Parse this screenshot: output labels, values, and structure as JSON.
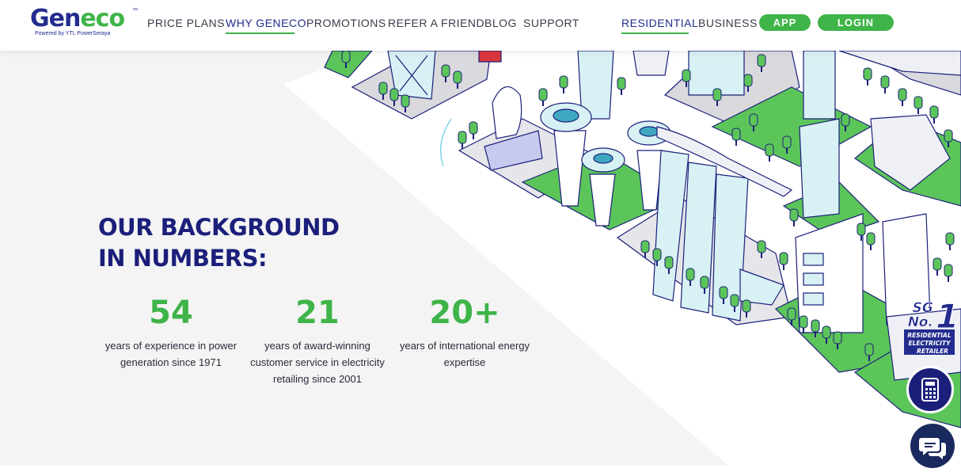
{
  "logo": {
    "brand_part1": "Gen",
    "brand_part2": "eco",
    "trademark": "™",
    "tagline": "Powered by YTL PowerSeraya"
  },
  "nav": {
    "items": [
      {
        "label": "PRICE PLANS"
      },
      {
        "label": "WHY GENECO"
      },
      {
        "label": "PROMOTIONS"
      },
      {
        "label": "REFER A FRIEND"
      },
      {
        "label": "BLOG"
      },
      {
        "label": "SUPPORT"
      }
    ],
    "segments": [
      {
        "label": "RESIDENTIAL"
      },
      {
        "label": "BUSINESS"
      }
    ],
    "app_label": "APP",
    "login_label": "LOGIN"
  },
  "section": {
    "heading_line1": "OUR BACKGROUND",
    "heading_line2": "IN NUMBERS:"
  },
  "stats": [
    {
      "value": "54",
      "desc_line1": "years of experience in power",
      "desc_line2": "generation since 1971",
      "desc_line3": ""
    },
    {
      "value": "21",
      "desc_line1": "years of award-winning",
      "desc_line2": "customer service in electricity",
      "desc_line3": "retailing since 2001"
    },
    {
      "value": "20+",
      "desc_line1": "years of international energy",
      "desc_line2": "expertise",
      "desc_line3": ""
    }
  ],
  "badge": {
    "line1": "SG",
    "line2": "No.",
    "number": "1",
    "line3": "RESIDENTIAL",
    "line4": "ELECTRICITY",
    "line5": "RETAILER"
  },
  "icons": {
    "calculator": "calculator-icon",
    "chat": "chat-icon"
  },
  "colors": {
    "brand_navy": "#1b1f7a",
    "brand_green": "#3fb449",
    "page_bg": "#f4f4f4"
  }
}
